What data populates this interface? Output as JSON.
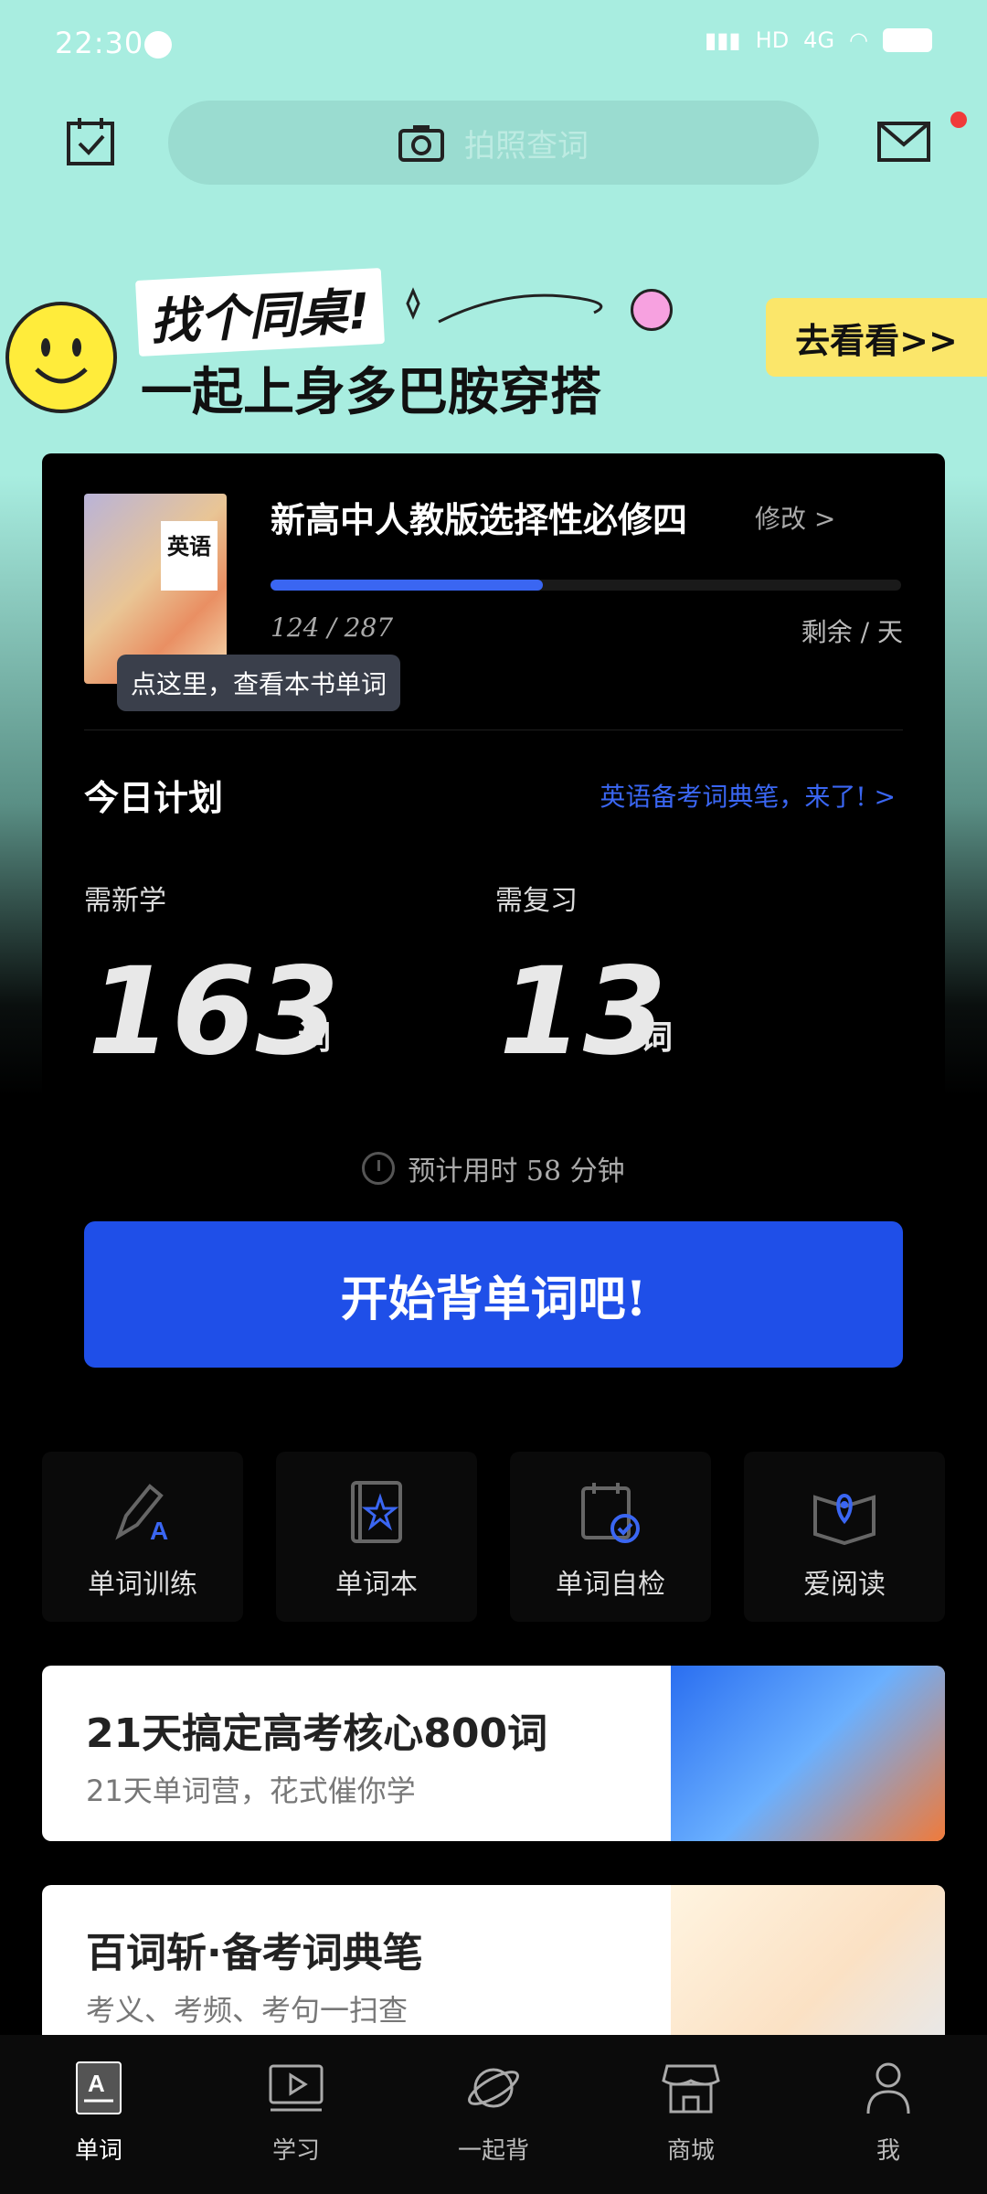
{
  "status_bar": {
    "time": "22:30",
    "network": "4G"
  },
  "search": {
    "placeholder": "拍照查词"
  },
  "banner": {
    "headline": "找个同桌!",
    "subline": "一起上身多巴胺穿搭",
    "cta": "去看看>>"
  },
  "book": {
    "cover_label": "英语",
    "title": "新高中人教版选择性必修四",
    "edit_label": "修改 >",
    "progress_text": "124 / 287",
    "progress_fraction": 0.432,
    "remaining": "剩余 / 天",
    "tooltip": "点这里，查看本书单词"
  },
  "plan": {
    "title": "今日计划",
    "ad": "英语备考词典笔，来了! >",
    "new_label": "需新学",
    "new_count": "163",
    "review_label": "需复习",
    "review_count": "13",
    "unit": "词",
    "estimate": "预计用时 58 分钟",
    "start_button": "开始背单词吧!"
  },
  "shortcuts": [
    {
      "label": "单词训练",
      "icon": "pencil-a-icon"
    },
    {
      "label": "单词本",
      "icon": "star-book-icon"
    },
    {
      "label": "单词自检",
      "icon": "calendar-check-icon"
    },
    {
      "label": "爱阅读",
      "icon": "open-book-pin-icon"
    }
  ],
  "promos": [
    {
      "title": "21天搞定高考核心800词",
      "subtitle": "21天单词营，花式催你学"
    },
    {
      "title": "百词斩·备考词典笔",
      "subtitle": "考义、考频、考句一扫查"
    }
  ],
  "nav": [
    {
      "label": "单词",
      "icon": "word-book-icon",
      "active": true
    },
    {
      "label": "学习",
      "icon": "video-play-icon"
    },
    {
      "label": "一起背",
      "icon": "planet-icon"
    },
    {
      "label": "商城",
      "icon": "store-icon"
    },
    {
      "label": "我",
      "icon": "user-icon"
    }
  ],
  "colors": {
    "accent": "#1f4fe8",
    "background_top": "#a8ede0",
    "banner_button": "#fbe66a"
  }
}
